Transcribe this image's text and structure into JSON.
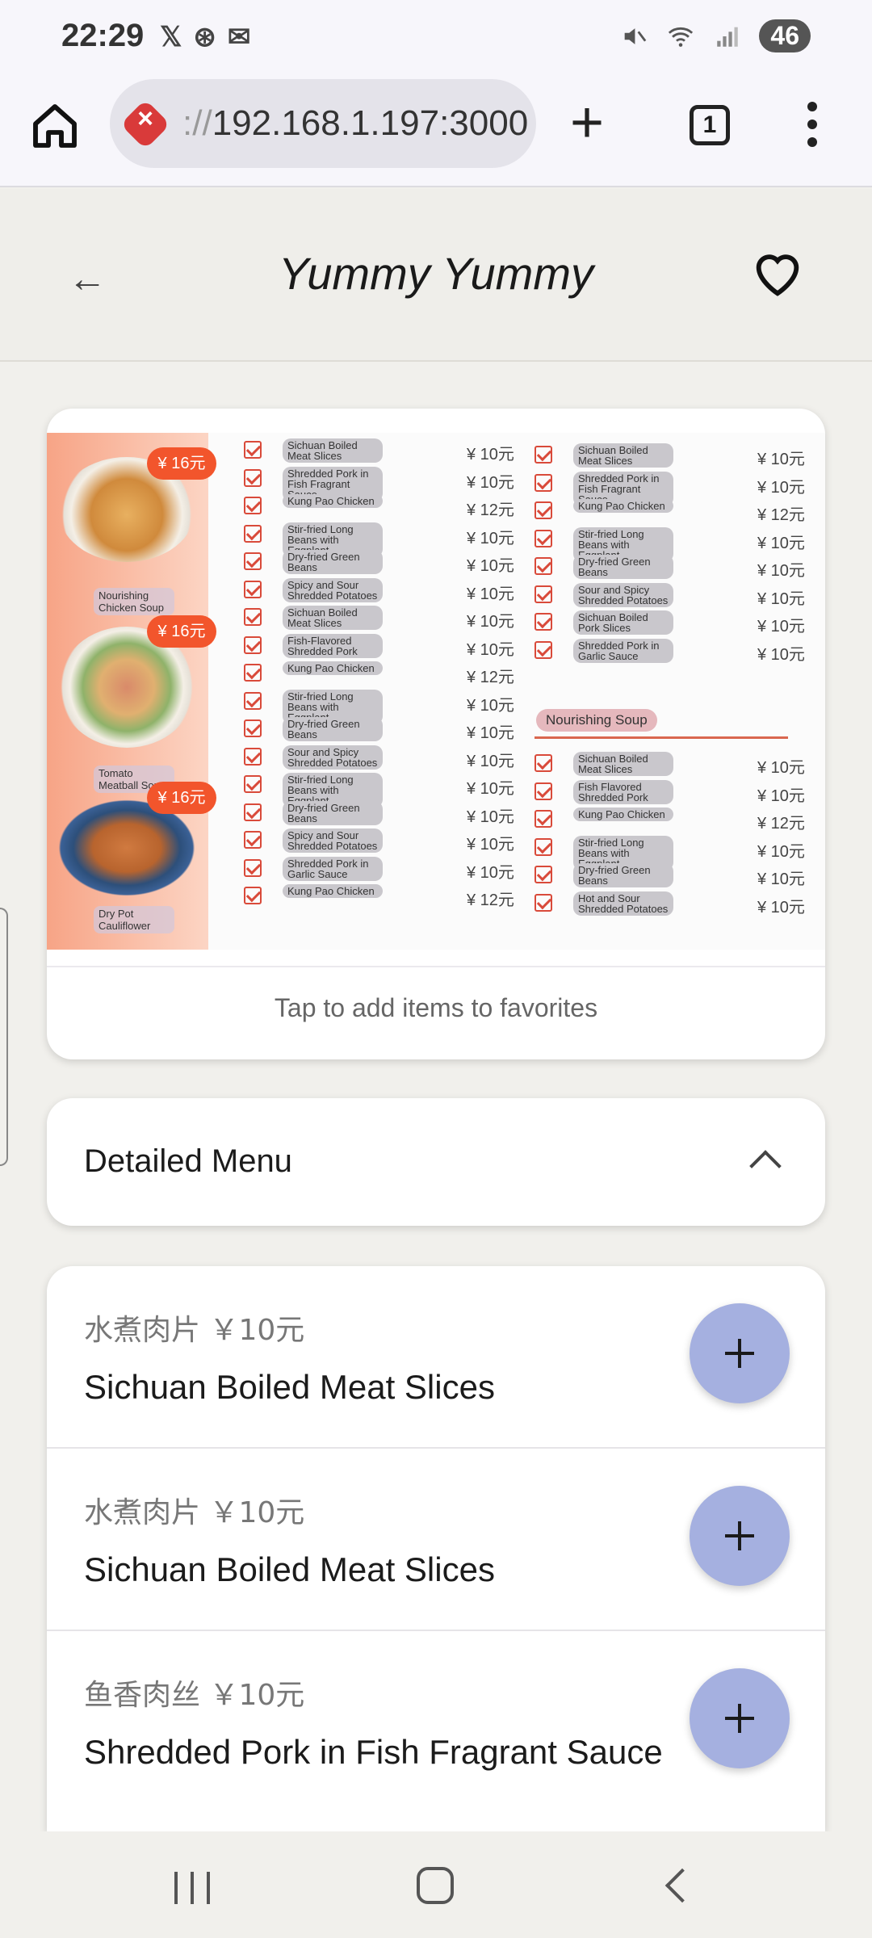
{
  "status_bar": {
    "time": "22:29",
    "battery": "46",
    "icons": [
      "x-app-icon",
      "sync-icon",
      "mail-icon",
      "mute-icon",
      "wifi-icon",
      "signal-icon"
    ]
  },
  "browser": {
    "url_prefix": "://",
    "url_host": "192.168.1.197:3000",
    "tab_count": "1"
  },
  "app_bar": {
    "title": "Yummy Yummy"
  },
  "menu_image": {
    "dishes": [
      {
        "label": "Nourishing Chicken Soup",
        "price": "¥ 16元"
      },
      {
        "label": "Tomato Meatball Soup",
        "price": "¥ 16元"
      },
      {
        "label": "Dry Pot Cauliflower",
        "price": "¥ 16元"
      }
    ],
    "col1": [
      {
        "name": "Sichuan Boiled Meat Slices",
        "price": "¥ 10元"
      },
      {
        "name": "Shredded Pork in Fish Fragrant Sauce",
        "price": "¥ 10元"
      },
      {
        "name": "Kung Pao Chicken",
        "price": "¥ 12元"
      },
      {
        "name": "Stir-fried Long Beans with Eggplant",
        "price": "¥ 10元"
      },
      {
        "name": "Dry-fried Green Beans",
        "price": "¥ 10元"
      },
      {
        "name": "Spicy and Sour Shredded Potatoes",
        "price": "¥ 10元"
      },
      {
        "name": "Sichuan Boiled Meat Slices",
        "price": "¥ 10元"
      },
      {
        "name": "Fish-Flavored Shredded Pork",
        "price": "¥ 10元"
      },
      {
        "name": "Kung Pao Chicken",
        "price": "¥ 12元"
      },
      {
        "name": "Stir-fried Long Beans with Eggplant",
        "price": "¥ 10元"
      },
      {
        "name": "Dry-fried Green Beans",
        "price": "¥ 10元"
      },
      {
        "name": "Sour and Spicy Shredded Potatoes",
        "price": "¥ 10元"
      },
      {
        "name": "Stir-fried Long Beans with Eggplant",
        "price": "¥ 10元"
      },
      {
        "name": "Dry-fried Green Beans",
        "price": "¥ 10元"
      },
      {
        "name": "Spicy and Sour Shredded Potatoes",
        "price": "¥ 10元"
      },
      {
        "name": "Shredded Pork in Garlic Sauce",
        "price": "¥ 10元"
      },
      {
        "name": "Kung Pao Chicken",
        "price": "¥ 12元"
      }
    ],
    "col2": [
      {
        "name": "Sichuan Boiled Meat Slices",
        "price": "¥ 10元"
      },
      {
        "name": "Shredded Pork in Fish Fragrant Sauce",
        "price": "¥ 10元"
      },
      {
        "name": "Kung Pao Chicken",
        "price": "¥ 12元"
      },
      {
        "name": "Stir-fried Long Beans with Eggplant",
        "price": "¥ 10元"
      },
      {
        "name": "Dry-fried Green Beans",
        "price": "¥ 10元"
      },
      {
        "name": "Sour and Spicy Shredded Potatoes",
        "price": "¥ 10元"
      },
      {
        "name": "Sichuan Boiled Pork Slices",
        "price": "¥ 10元"
      },
      {
        "name": "Shredded Pork in Garlic Sauce",
        "price": "¥ 10元"
      }
    ],
    "soup_header": "Nourishing Soup",
    "col3": [
      {
        "name": "Sichuan Boiled Meat Slices",
        "price": "¥ 10元"
      },
      {
        "name": "Fish Flavored Shredded Pork",
        "price": "¥ 10元"
      },
      {
        "name": "Kung Pao Chicken",
        "price": "¥ 12元"
      },
      {
        "name": "Stir-fried Long Beans with Eggplant",
        "price": "¥ 10元"
      },
      {
        "name": "Dry-fried Green Beans",
        "price": "¥ 10元"
      },
      {
        "name": "Hot and Sour Shredded Potatoes",
        "price": "¥ 10元"
      }
    ]
  },
  "favorites_hint": "Tap to add items to favorites",
  "detailed_menu": {
    "title": "Detailed Menu"
  },
  "items": [
    {
      "chinese": "水煮肉片 ￥10元",
      "name": "Sichuan Boiled Meat Slices"
    },
    {
      "chinese": "水煮肉片 ￥10元",
      "name": "Sichuan Boiled Meat Slices"
    },
    {
      "chinese": "鱼香肉丝 ￥10元",
      "name": "Shredded Pork in Fish Fragrant Sauce"
    }
  ],
  "colors": {
    "accent": "#a5b0e0",
    "background": "#f1f0ec",
    "menu_red": "#d94a3a"
  }
}
